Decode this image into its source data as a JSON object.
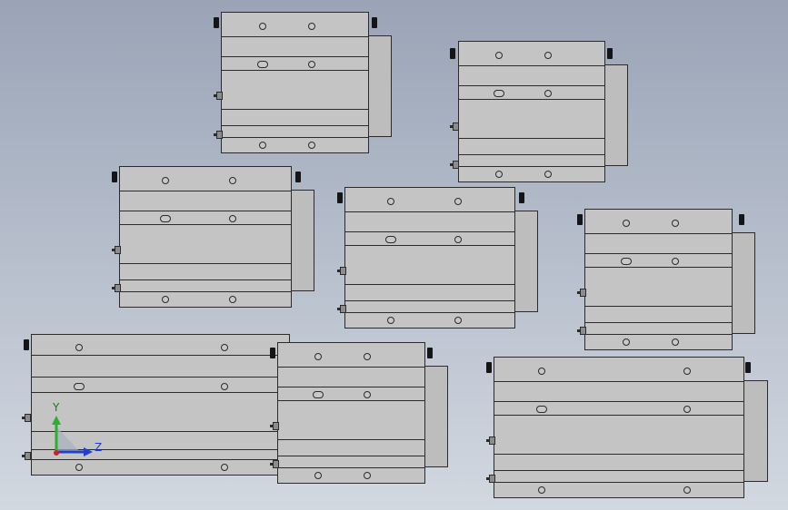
{
  "viewport": {
    "background_top": "#9aa4b6",
    "background_bottom": "#d2d8e0",
    "part_color": "#c4c4c4",
    "edge_color": "#2b2b2b"
  },
  "parts_count_label": "",
  "triad": {
    "y_label": "Y",
    "z_label": "Z",
    "y_color": "#2bb02b",
    "z_color": "#1f3fd0",
    "x_color": "#d02020"
  }
}
